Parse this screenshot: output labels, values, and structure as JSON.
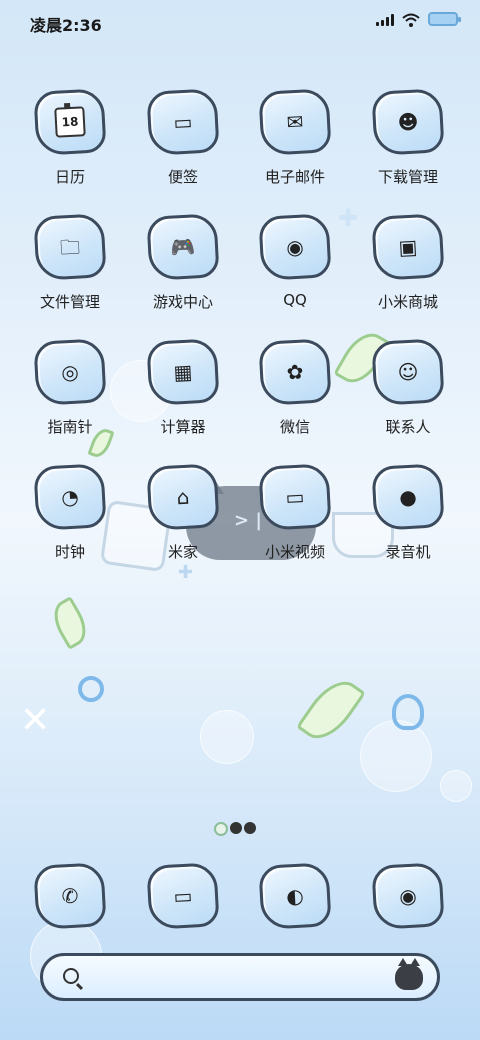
{
  "status_bar": {
    "time": "凌晨2:36"
  },
  "apps": [
    {
      "label": "日历",
      "icon": "calendar-icon",
      "glyph": "18"
    },
    {
      "label": "便签",
      "icon": "notes-icon",
      "glyph": "▭"
    },
    {
      "label": "电子邮件",
      "icon": "email-icon",
      "glyph": "✉"
    },
    {
      "label": "下载管理",
      "icon": "download-icon",
      "glyph": "☻"
    },
    {
      "label": "文件管理",
      "icon": "folder-icon",
      "glyph": "🗀"
    },
    {
      "label": "游戏中心",
      "icon": "gamepad-icon",
      "glyph": "🎮"
    },
    {
      "label": "QQ",
      "icon": "qq-icon",
      "glyph": "◉"
    },
    {
      "label": "小米商城",
      "icon": "shop-icon",
      "glyph": "▣"
    },
    {
      "label": "指南针",
      "icon": "compass-icon",
      "glyph": "◎"
    },
    {
      "label": "计算器",
      "icon": "calculator-icon",
      "glyph": "▦"
    },
    {
      "label": "微信",
      "icon": "wechat-icon",
      "glyph": "✿"
    },
    {
      "label": "联系人",
      "icon": "contacts-icon",
      "glyph": "☺"
    },
    {
      "label": "时钟",
      "icon": "clock-icon",
      "glyph": "◔"
    },
    {
      "label": "米家",
      "icon": "home-icon",
      "glyph": "⌂"
    },
    {
      "label": "小米视频",
      "icon": "tv-icon",
      "glyph": "▭"
    },
    {
      "label": "录音机",
      "icon": "recorder-icon",
      "glyph": "●"
    }
  ],
  "dock": [
    {
      "icon": "phone-icon",
      "glyph": "✆"
    },
    {
      "icon": "messages-icon",
      "glyph": "▭"
    },
    {
      "icon": "browser-icon",
      "glyph": "◐"
    },
    {
      "icon": "camera-icon",
      "glyph": "◉"
    }
  ],
  "search": {
    "placeholder": ""
  }
}
